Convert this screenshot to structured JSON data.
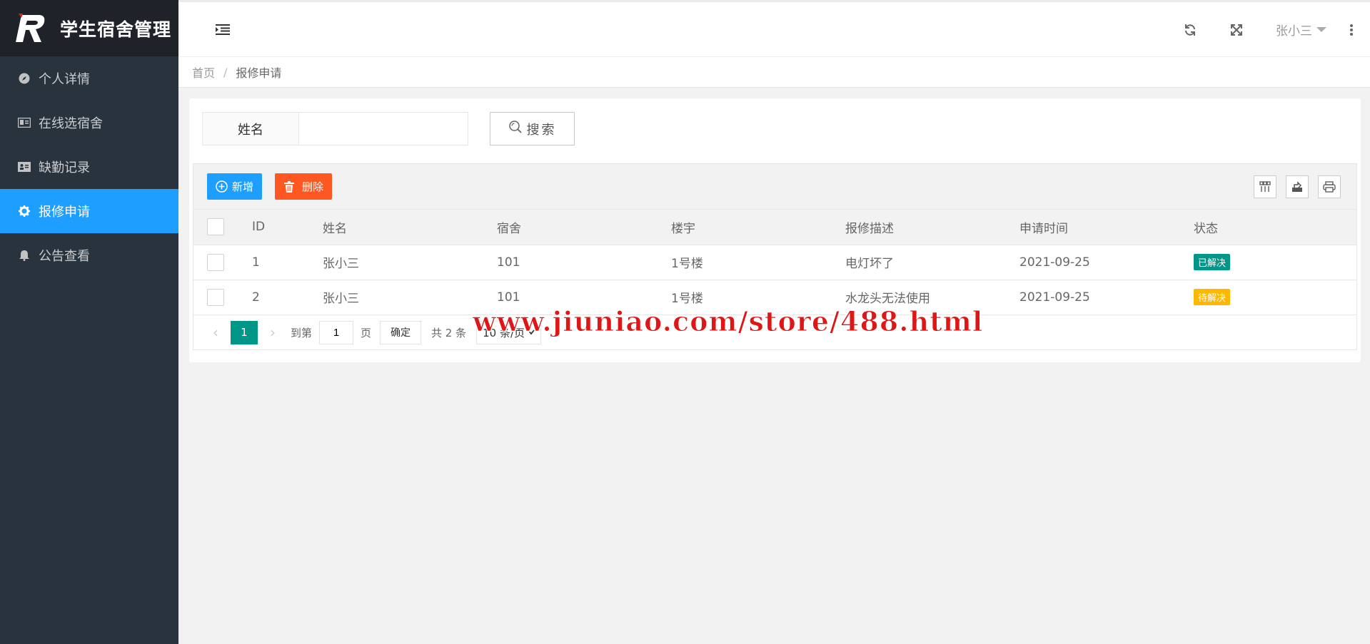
{
  "app": {
    "title": "学生宿舍管理"
  },
  "sidebar": {
    "items": [
      {
        "label": "个人详情",
        "icon": "compass-icon",
        "active": false
      },
      {
        "label": "在线选宿舍",
        "icon": "id-card-icon",
        "active": false
      },
      {
        "label": "缺勤记录",
        "icon": "id-card-icon",
        "active": false
      },
      {
        "label": "报修申请",
        "icon": "gear-icon",
        "active": true
      },
      {
        "label": "公告查看",
        "icon": "bell-icon",
        "active": false
      }
    ]
  },
  "header": {
    "user": "张小三"
  },
  "breadcrumb": {
    "home": "首页",
    "sep": "/",
    "current": "报修申请"
  },
  "search": {
    "label": "姓名",
    "value": "",
    "button": "搜索"
  },
  "toolbar": {
    "add_label": "新增",
    "delete_label": "删除"
  },
  "table": {
    "columns": [
      "ID",
      "姓名",
      "宿舍",
      "楼宇",
      "报修描述",
      "申请时间",
      "状态"
    ],
    "rows": [
      {
        "id": "1",
        "name": "张小三",
        "dorm": "101",
        "building": "1号楼",
        "desc": "电灯坏了",
        "time": "2021-09-25",
        "status": "已解决",
        "status_color": "#009688"
      },
      {
        "id": "2",
        "name": "张小三",
        "dorm": "101",
        "building": "1号楼",
        "desc": "水龙头无法使用",
        "time": "2021-09-25",
        "status": "待解决",
        "status_color": "#ffb800"
      }
    ]
  },
  "pager": {
    "current": "1",
    "goto_label": "到第",
    "goto_value": "1",
    "page_label": "页",
    "confirm": "确定",
    "total": "共 2 条",
    "per_page": "10 条/页"
  },
  "watermark": "www.jiuniao.com/store/488.html",
  "colors": {
    "sidebar_bg": "#28333e",
    "active": "#1e9fff",
    "add": "#1e9fff",
    "delete": "#ff5722",
    "page_active": "#009688"
  }
}
